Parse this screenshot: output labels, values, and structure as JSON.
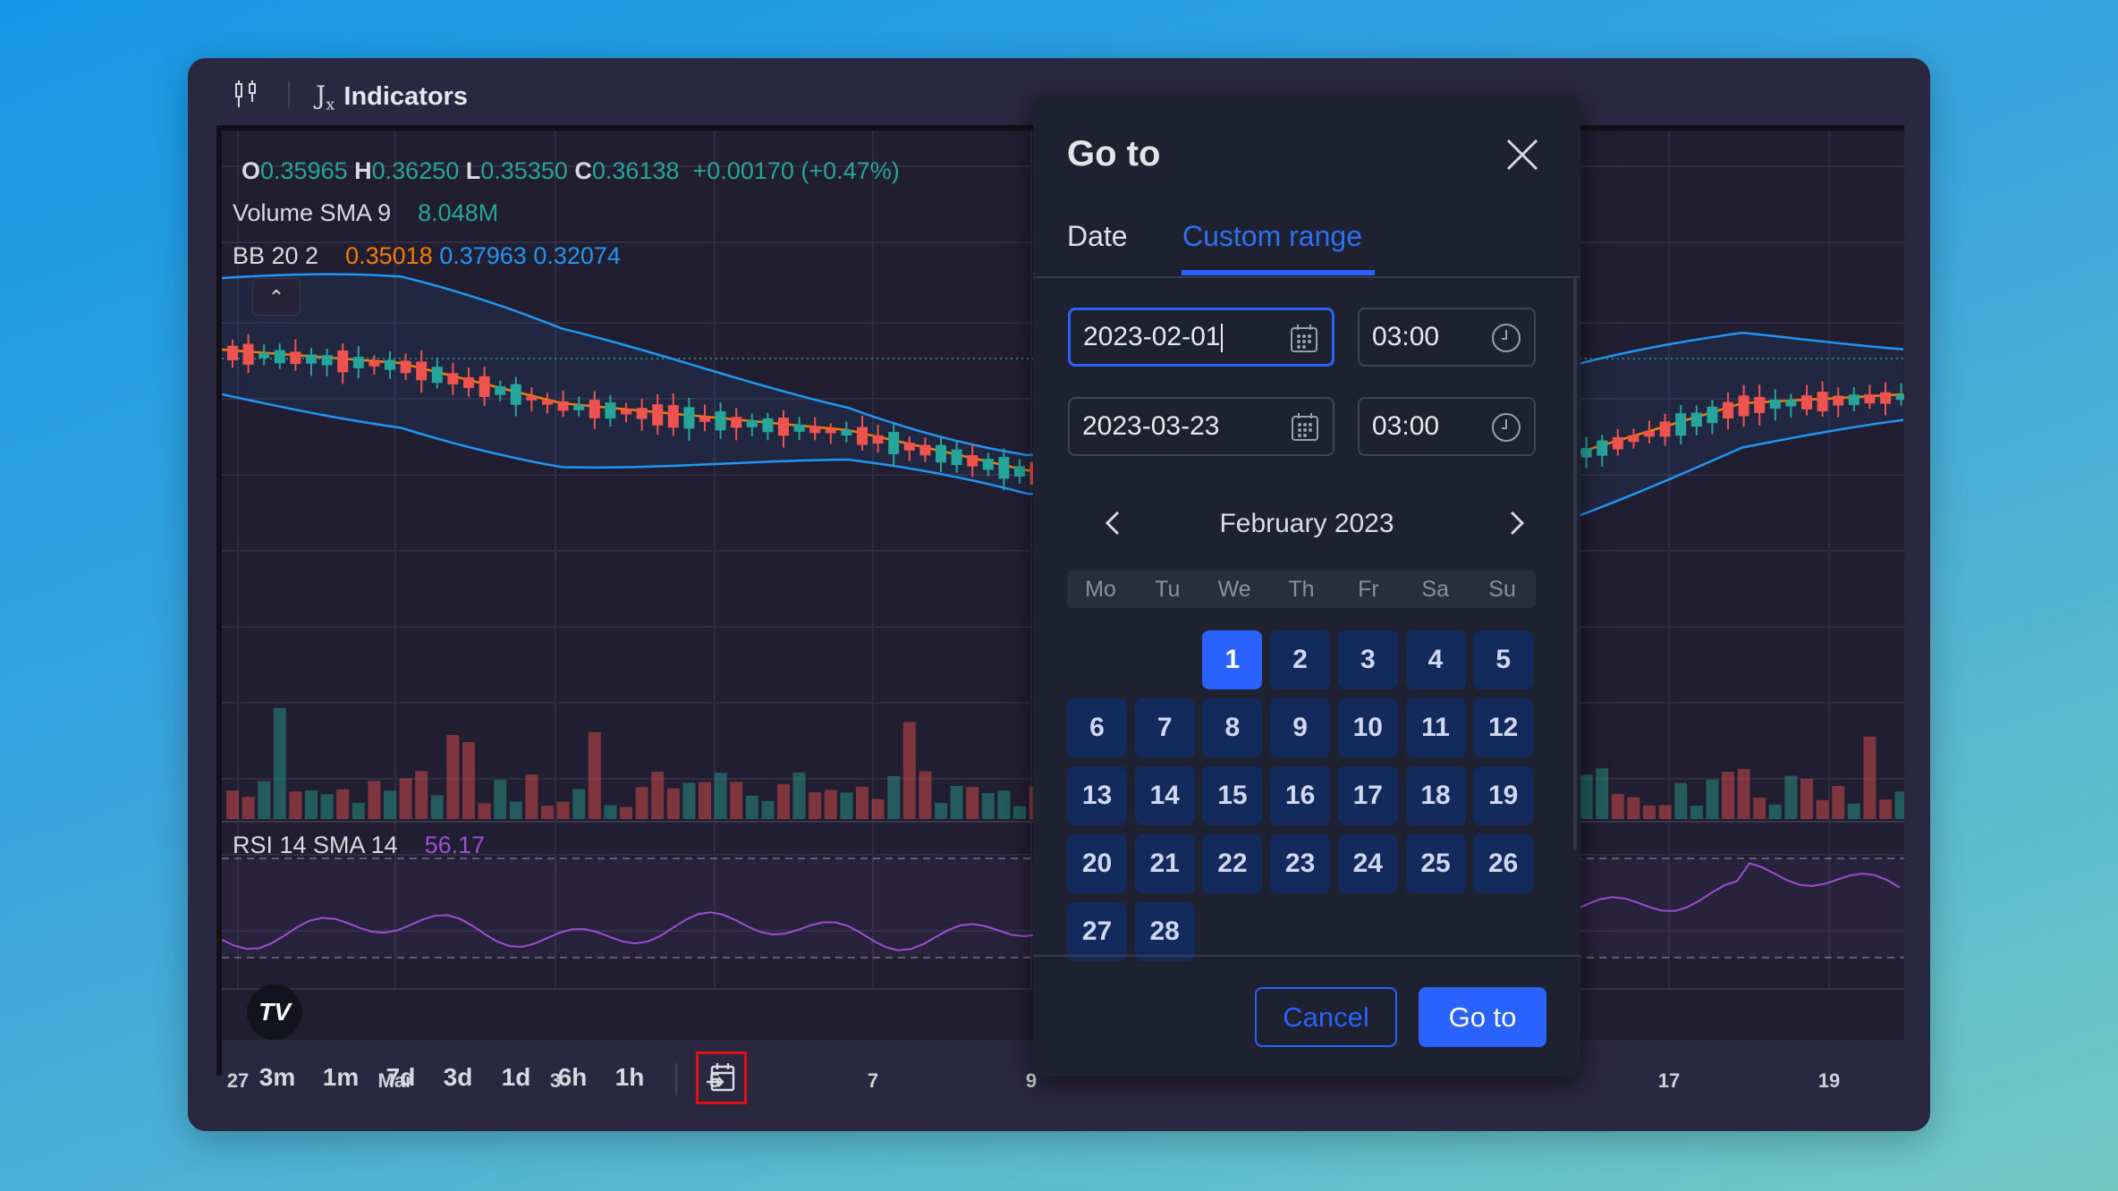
{
  "toolbar": {
    "chart_type_icon": "candles-icon",
    "indicators_icon": "function-fx-icon",
    "indicators_label": "Indicators"
  },
  "legend": {
    "ohlc": {
      "o_key": "O",
      "o": "0.35965",
      "h_key": "H",
      "h": "0.36250",
      "l_key": "L",
      "l": "0.35350",
      "c_key": "C",
      "c": "0.36138",
      "change": "+0.00170 (+0.47%)"
    },
    "volume": {
      "name": "Volume SMA 9",
      "value": "8.048M"
    },
    "bb": {
      "name": "BB 20 2",
      "basis": "0.35018",
      "upper": "0.37963",
      "lower": "0.32074"
    },
    "rsi": {
      "name": "RSI 14 SMA 14",
      "value": "56.17"
    }
  },
  "colors": {
    "up": "#26a69a",
    "down": "#ef5350",
    "bb_basis": "#f57c00",
    "bb_band": "#2196f3",
    "rsi": "#9c4fd1",
    "accent": "#2962ff"
  },
  "x_axis": [
    "27",
    "Mar",
    "3",
    "5",
    "7",
    "9",
    "17",
    "19"
  ],
  "timeframes": [
    "3m",
    "1m",
    "7d",
    "3d",
    "1d",
    "6h",
    "1h"
  ],
  "goto_button_icon": "calendar-goto-icon",
  "dialog": {
    "title": "Go to",
    "tabs": [
      {
        "label": "Date",
        "active": false
      },
      {
        "label": "Custom range",
        "active": true
      }
    ],
    "start_date": "2023-02-01",
    "start_time": "03:00",
    "end_date": "2023-03-23",
    "end_time": "03:00",
    "month_label": "February 2023",
    "weekdays": [
      "Mo",
      "Tu",
      "We",
      "Th",
      "Fr",
      "Sa",
      "Su"
    ],
    "first_weekday_index": 2,
    "days_in_month": 28,
    "selected_day": 1,
    "cancel_label": "Cancel",
    "goto_label": "Go to"
  }
}
